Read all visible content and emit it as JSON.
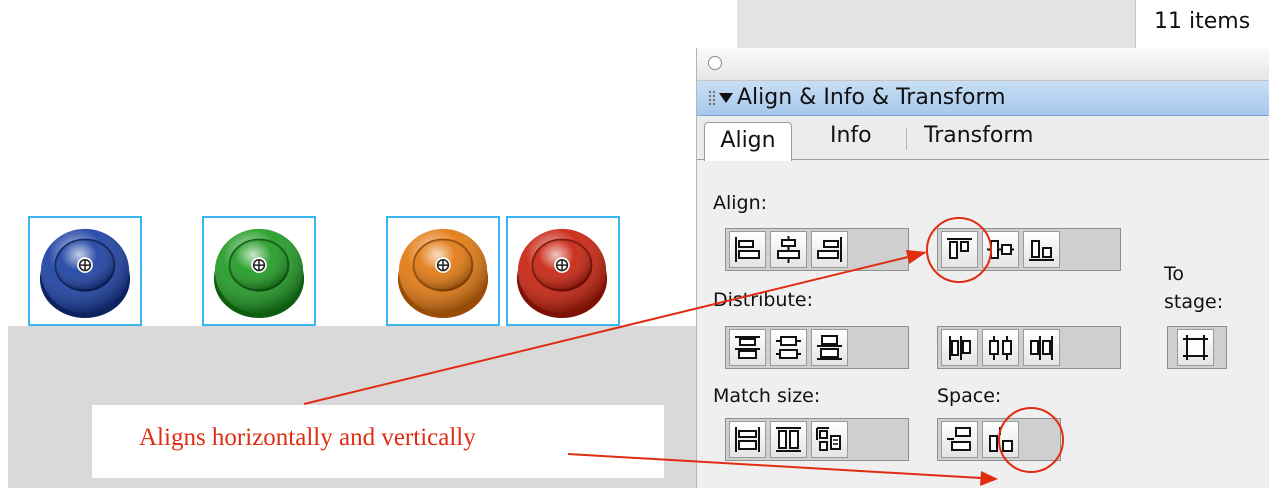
{
  "status_bar": {
    "item_count": "11 items"
  },
  "panel": {
    "title": "Align & Info & Transform",
    "tabs": [
      {
        "label": "Align",
        "active": true
      },
      {
        "label": "Info",
        "active": false
      },
      {
        "label": "Transform",
        "active": false
      }
    ],
    "sections": {
      "align": "Align:",
      "distribute": "Distribute:",
      "match_size": "Match size:",
      "space": "Space:",
      "to_stage": "To\nstage:"
    },
    "tools": {
      "align": [
        "align-left-edge-icon",
        "align-horizontal-center-icon",
        "align-right-edge-icon",
        "align-top-edge-icon",
        "align-vertical-center-icon",
        "align-bottom-edge-icon"
      ],
      "distribute": [
        "distribute-top-edge-icon",
        "distribute-vertical-center-icon",
        "distribute-bottom-edge-icon",
        "distribute-left-edge-icon",
        "distribute-horizontal-center-icon",
        "distribute-right-edge-icon"
      ],
      "match_size": [
        "match-width-icon",
        "match-height-icon",
        "match-width-and-height-icon"
      ],
      "space": [
        "space-evenly-vertically-icon",
        "space-evenly-horizontally-icon"
      ],
      "to_stage": "align-to-stage-icon"
    }
  },
  "stage": {
    "buttons": [
      {
        "name": "blue-button",
        "color": "#1a3fa3"
      },
      {
        "name": "green-button",
        "color": "#1f9a22"
      },
      {
        "name": "orange-button",
        "color": "#e2780f"
      },
      {
        "name": "red-button",
        "color": "#c8200c"
      }
    ]
  },
  "annotation": {
    "text": "Aligns horizontally and vertically",
    "color": "#e02d12",
    "circled_tools": [
      "align-top-edge-icon",
      "space-evenly-horizontally-icon"
    ]
  }
}
